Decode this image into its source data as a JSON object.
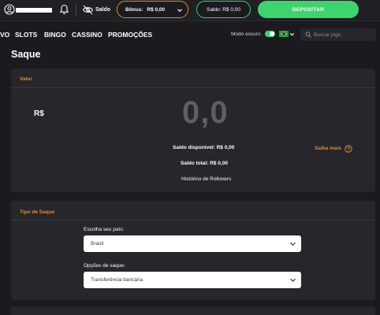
{
  "topbar": {
    "saldo_toggle_label": "Saldo",
    "bonus_label": "Bônus:",
    "bonus_value": "R$ 0,00",
    "saldo_label": "Saldo: R$ 0,00",
    "deposit_label": "DEPOSITAR"
  },
  "nav": {
    "items": [
      "VO",
      "SLOTS",
      "BINGO",
      "CASSINO",
      "PROMOÇÕES"
    ],
    "dark_mode_label": "Modo escuro",
    "search_placeholder": "Buscar jogo"
  },
  "page": {
    "title": "Saque"
  },
  "valor_section": {
    "label": "Valor",
    "currency": "R$",
    "amount": "0,0",
    "available": "Saldo disponível: R$ 0,00",
    "total": "Saldo total: R$ 0,00",
    "history_link": "Histórico de Rollovers",
    "learn_more": "Saiba mais"
  },
  "tipo_section": {
    "label": "Tipo de Saque",
    "country_label": "Escolha seu país:",
    "country_value": "Brasil",
    "options_label": "Opções de saque:",
    "options_value": "Transferência bancária"
  },
  "colors": {
    "accent_orange": "#e08a36",
    "accent_green": "#3ed36e",
    "background": "#1b1b1f",
    "card": "#26262b"
  }
}
